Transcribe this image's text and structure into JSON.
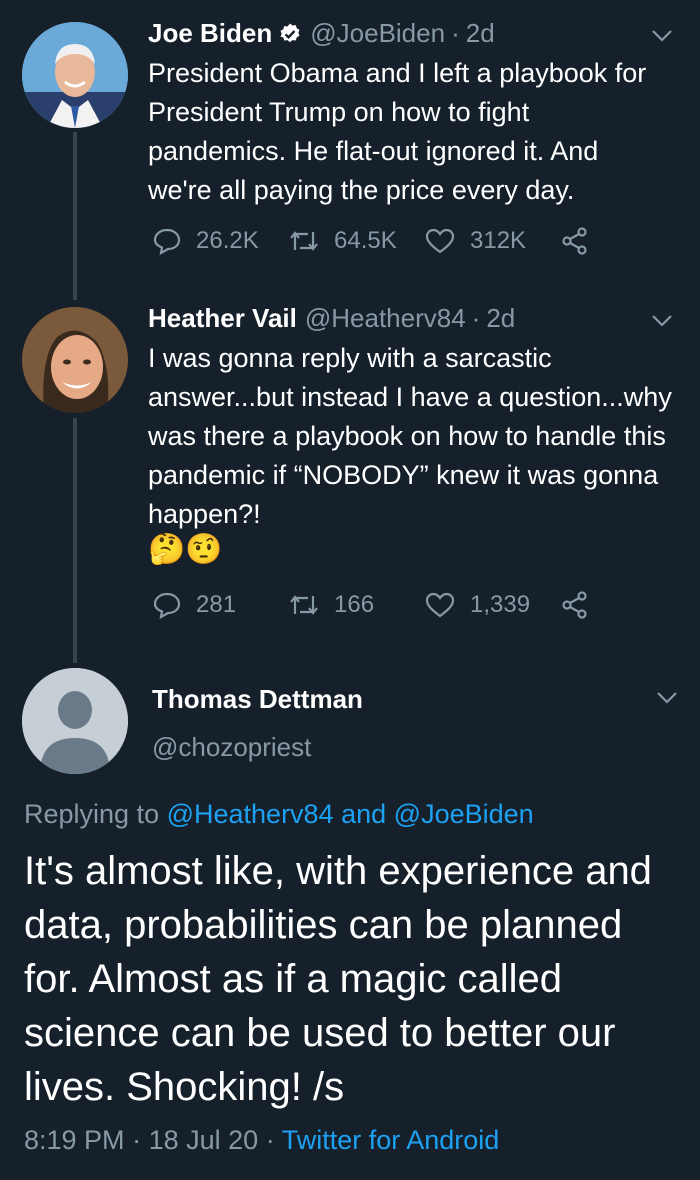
{
  "tweets": [
    {
      "name": "Joe Biden",
      "verified": true,
      "handle": "@JoeBiden",
      "age": "2d",
      "text": "President Obama and I left a playbook for President Trump on how to fight pandemics. He flat-out ignored it. And we're all paying the price every day.",
      "replies": "26.2K",
      "retweets": "64.5K",
      "likes": "312K"
    },
    {
      "name": "Heather Vail",
      "handle": "@Heatherv84",
      "age": "2d",
      "text": "I was gonna reply with a sarcastic answer...but instead I have a question...why was there a playbook on how to handle this pandemic if “NOBODY” knew it was gonna happen?!",
      "emojis": "🤔🤨",
      "replies": "281",
      "retweets": "166",
      "likes": "1,339"
    }
  ],
  "main_tweet": {
    "name": "Thomas Dettman",
    "handle": "@chozopriest",
    "replying_prefix": "Replying to ",
    "replying_to_1": "@Heatherv84",
    "replying_and": " and ",
    "replying_to_2": "@JoeBiden",
    "text": "It's almost like, with experience and data, probabilities can be planned for. Almost as if a magic called science can be used to better our lives. Shocking! /s",
    "time": "8:19 PM",
    "date": "18 Jul 20",
    "separator": "·",
    "source": "Twitter for Android"
  },
  "colors": {
    "background": "#15202b",
    "secondary_text": "#8899a6",
    "link": "#1da1f2",
    "verified_badge": "#ffffff"
  }
}
